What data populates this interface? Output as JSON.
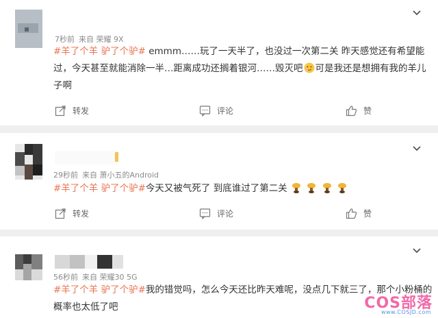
{
  "posts": [
    {
      "meta": {
        "time": "7秒前",
        "source": "来自 荣耀 9X"
      },
      "name": "",
      "text": {
        "tag": "#羊了个羊 驴了个驴#",
        "body": " emmm……玩了一天半了，也没过一次第二关 昨天感觉还有希望能过，今天甚至就能消除一半…距离成功还搁着银河……毁灭吧",
        "emoji": "smirk-emoji",
        "tail": "可是我还是想拥有我的羊儿子啊"
      }
    },
    {
      "meta": {
        "time": "29秒前",
        "source": "来自 萧小五的Android"
      },
      "name": "",
      "text": {
        "tag": "#羊了个羊 驴了个驴#",
        "body": "今天又被气死了 到底谁过了第二关"
      }
    },
    {
      "meta": {
        "time": "56秒前",
        "source": "来自 荣耀30 5G"
      },
      "name": "",
      "text": {
        "tag": "#羊了个羊 驴了个驴#",
        "body": "我的错觉吗，怎么今天还比昨天难呢，没点几下就三了，那个小粉桶的概率也太低了吧"
      }
    }
  ],
  "actions": {
    "repost": "转发",
    "comment": "评论",
    "like": "赞"
  },
  "watermark": {
    "main": "COS部落",
    "sub": "www.COSJD.com"
  },
  "colors": {
    "accent": "#eb7350",
    "watermark_pink": "#f16aa8",
    "watermark_blue": "#5b8fd8"
  }
}
